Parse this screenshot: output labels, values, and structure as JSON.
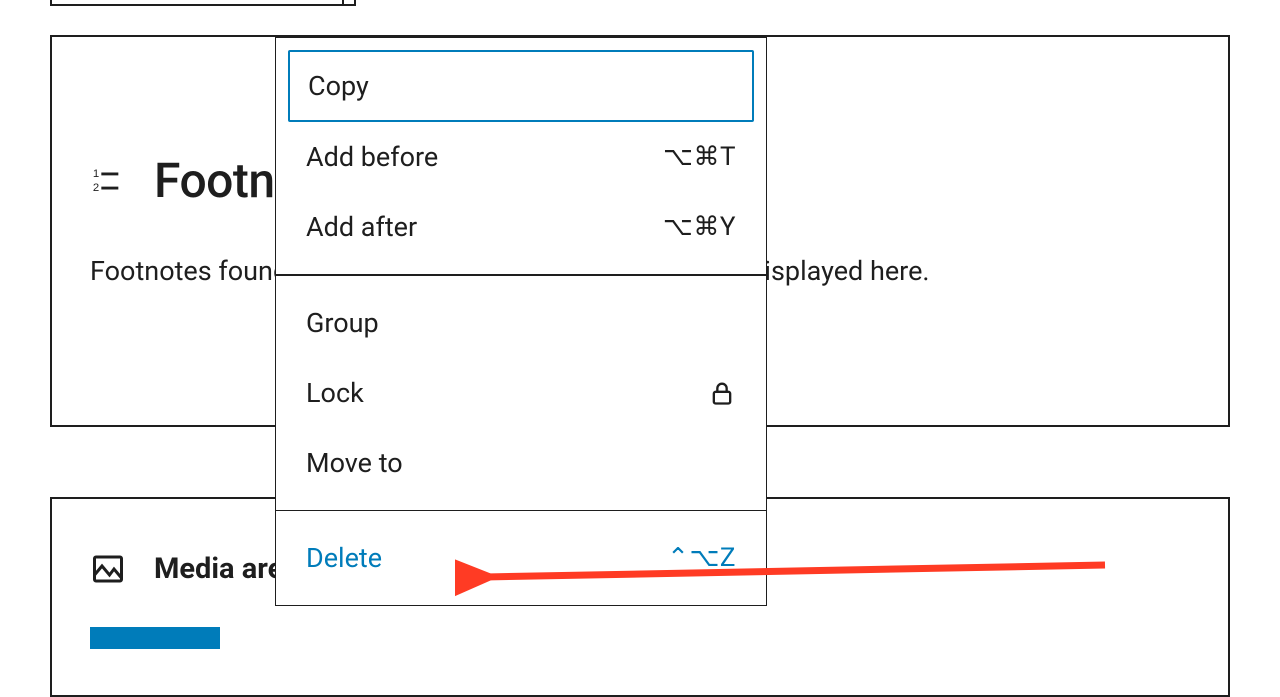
{
  "footnotes_block": {
    "title": "Footnotes",
    "description": "Footnotes found in blocks within this document will be displayed here."
  },
  "media_block": {
    "title": "Media area"
  },
  "context_menu": {
    "groups": [
      [
        {
          "key": "copy",
          "label": "Copy",
          "shortcut": "",
          "focused": true
        },
        {
          "key": "add-before",
          "label": "Add before",
          "shortcut": "⌥⌘T"
        },
        {
          "key": "add-after",
          "label": "Add after",
          "shortcut": "⌥⌘Y"
        }
      ],
      [
        {
          "key": "group",
          "label": "Group",
          "shortcut": ""
        },
        {
          "key": "lock",
          "label": "Lock",
          "shortcut": "",
          "icon": "lock"
        },
        {
          "key": "move-to",
          "label": "Move to",
          "shortcut": ""
        }
      ],
      [
        {
          "key": "delete",
          "label": "Delete",
          "shortcut": "⌃⌥Z",
          "variant": "delete"
        }
      ]
    ]
  },
  "annotation": {
    "color": "#ff3b24"
  }
}
